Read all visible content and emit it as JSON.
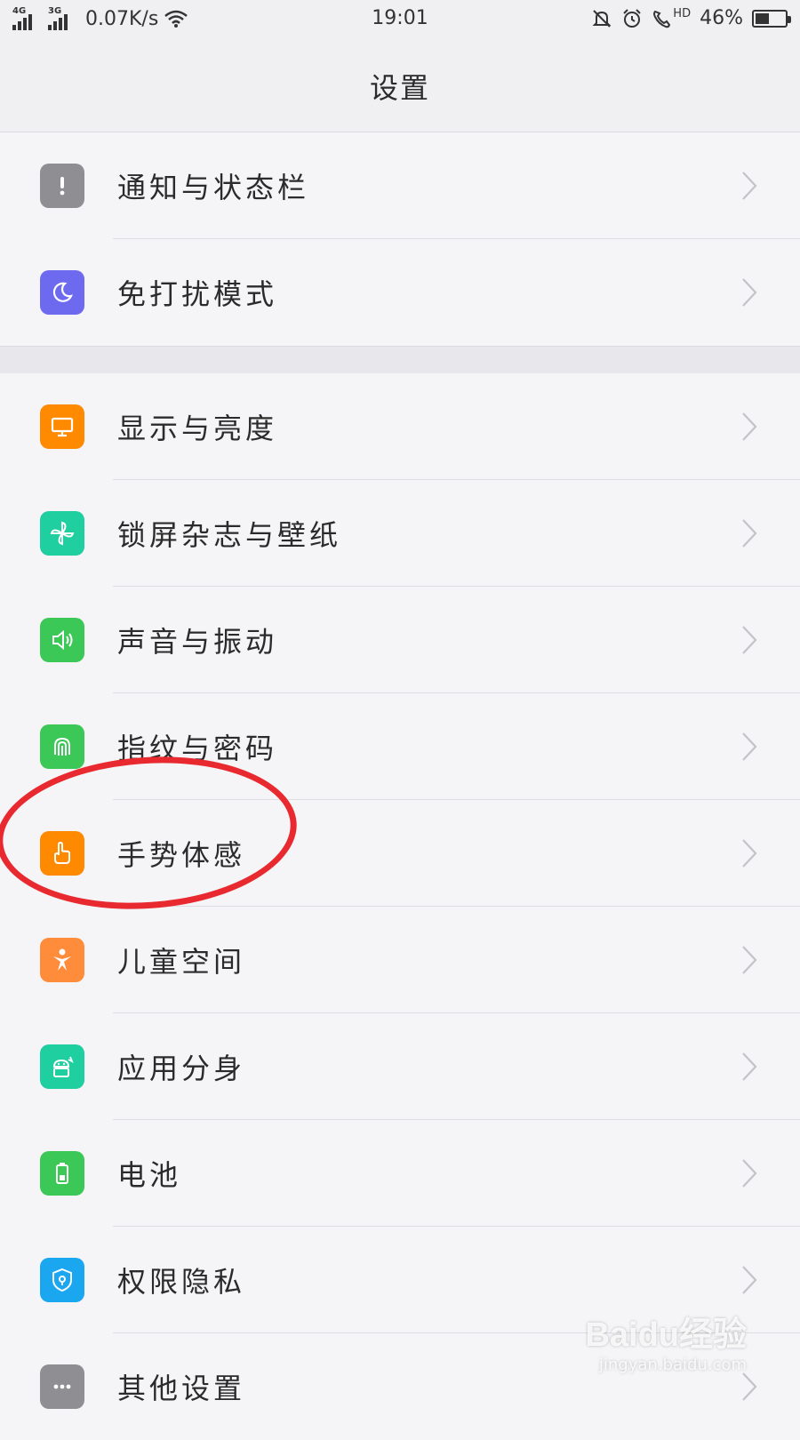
{
  "status_bar": {
    "net1": "4G",
    "net2": "3G",
    "speed": "0.07K/s",
    "time": "19:01",
    "hd": "HD",
    "battery": "46%",
    "battery_level": 0.46
  },
  "header": {
    "title": "设置"
  },
  "groups": [
    {
      "items": [
        {
          "label": "通知与状态栏",
          "icon": "notification-icon",
          "color": "#8e8e93"
        },
        {
          "label": "免打扰模式",
          "icon": "moon-icon",
          "color": "#6e6af0"
        }
      ]
    },
    {
      "items": [
        {
          "label": "显示与亮度",
          "icon": "display-icon",
          "color": "#ff8a00"
        },
        {
          "label": "锁屏杂志与壁纸",
          "icon": "pinwheel-icon",
          "color": "#1fcf9f"
        },
        {
          "label": "声音与振动",
          "icon": "speaker-icon",
          "color": "#3cc857"
        },
        {
          "label": "指纹与密码",
          "icon": "fingerprint-icon",
          "color": "#3cc857"
        },
        {
          "label": "手势体感",
          "icon": "gesture-icon",
          "color": "#ff8a00"
        },
        {
          "label": "儿童空间",
          "icon": "child-icon",
          "color": "#ff8c3a"
        },
        {
          "label": "应用分身",
          "icon": "app-clone-icon",
          "color": "#1fcf9f"
        },
        {
          "label": "电池",
          "icon": "battery-icon",
          "color": "#3cc857"
        },
        {
          "label": "权限隐私",
          "icon": "shield-icon",
          "color": "#1aa7f0"
        },
        {
          "label": "其他设置",
          "icon": "more-icon",
          "color": "#8e8e93"
        }
      ]
    }
  ],
  "annotation_color": "#e8292f",
  "watermark": {
    "brand": "Baidu经验",
    "url": "jingyan.baidu.com"
  }
}
